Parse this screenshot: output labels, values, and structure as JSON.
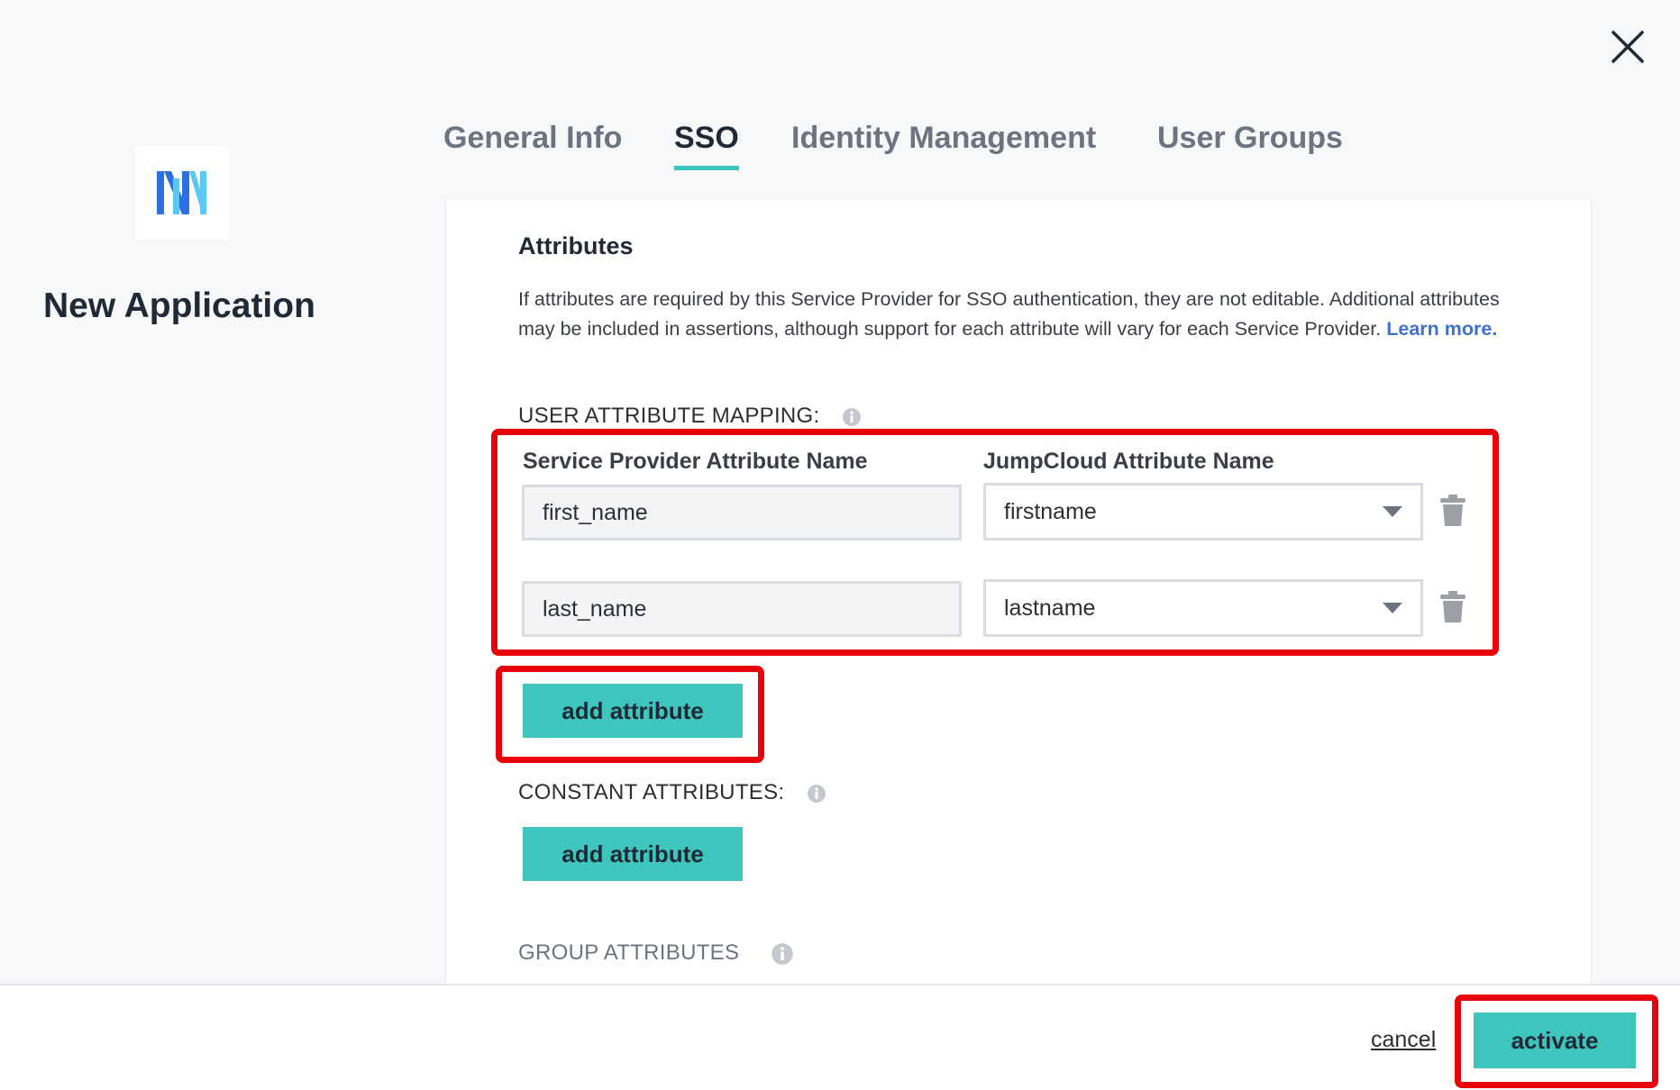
{
  "header": {
    "app_title": "New Application",
    "tabs": [
      {
        "label": "General Info",
        "active": false
      },
      {
        "label": "SSO",
        "active": true
      },
      {
        "label": "Identity Management",
        "active": false
      },
      {
        "label": "User Groups",
        "active": false
      }
    ]
  },
  "attributes": {
    "title": "Attributes",
    "description": "If attributes are required by this Service Provider for SSO authentication, they are not editable. Additional attributes may be included in assertions, although support for each attribute will vary for each Service Provider.",
    "learn_more": "Learn more.",
    "user_mapping_label": "USER ATTRIBUTE MAPPING:",
    "col_sp": "Service Provider Attribute Name",
    "col_jc": "JumpCloud Attribute Name",
    "rows": [
      {
        "sp_value": "first_name",
        "jc_value": "firstname"
      },
      {
        "sp_value": "last_name",
        "jc_value": "lastname"
      }
    ],
    "add_attribute_label": "add attribute",
    "constant_label": "CONSTANT ATTRIBUTES:",
    "constant_add_label": "add attribute",
    "group_label": "GROUP ATTRIBUTES"
  },
  "footer": {
    "cancel_label": "cancel",
    "activate_label": "activate"
  },
  "colors": {
    "accent_teal": "#3ec5bd",
    "highlight_red": "#e8000b",
    "link_blue": "#3f72c9",
    "logo_blue": "#2f6fe4",
    "logo_cyan": "#5cc7f0"
  }
}
